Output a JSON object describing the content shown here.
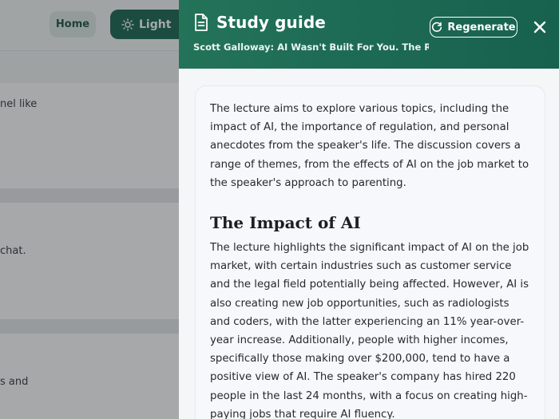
{
  "background": {
    "home_label": "Home",
    "light_label": "Light",
    "snippets": [
      "nel like",
      "chat.",
      "s and"
    ]
  },
  "drawer": {
    "title": "Study guide",
    "subtitle": "Scott Galloway: AI Wasn't Built For You. The Rich D...",
    "regenerate_label": "Regenerate",
    "intro": "The lecture aims to explore various topics, including the impact of AI, the importance of regulation, and personal anecdotes from the speaker's life. The discussion covers a range of themes, from the effects of AI on the job market to the speaker's approach to parenting.",
    "section_heading": "The Impact of AI",
    "section_body": "The lecture highlights the significant impact of AI on the job market, with certain industries such as customer service and the legal field potentially being affected. However, AI is also creating new job opportunities, such as radiologists and coders, with the latter experiencing an 11% year-over-year increase. Additionally, people with higher incomes, specifically those making over $200,000, tend to have a positive view of AI. The speaker's company has hired 220 people in the last 24 months, with a focus on creating high-paying jobs that require AI fluency."
  },
  "colors": {
    "header_start": "#237359",
    "header_end": "#17614f",
    "accent": "#1f6b55"
  }
}
